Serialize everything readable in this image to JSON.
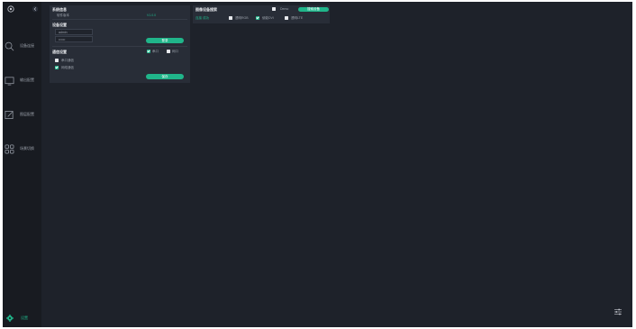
{
  "sidebar": {
    "items": [
      {
        "label": "设备连接"
      },
      {
        "label": "输出配置"
      },
      {
        "label": "图层配置"
      },
      {
        "label": "场景切换"
      }
    ],
    "settings_label": "设置"
  },
  "basic_info": {
    "title": "系统信息",
    "row_label": "软件版本",
    "row_value": "V1.0.0"
  },
  "device_settings": {
    "title": "设备设置",
    "username_value": "admin",
    "password_value": "••••••",
    "login_button": "登录"
  },
  "comm_settings": {
    "title": "通信设置",
    "opt_a": "串口",
    "opt_b": "网口",
    "serial_label": "串口通信",
    "network_label": "网络通信",
    "save_button": "保存"
  },
  "right_panel": {
    "title": "图像设备搜索",
    "demo_label": "Demo",
    "connect_button": "搜索设备",
    "status_text": "连接 成功",
    "option1": "透明RGB",
    "option2": "使能DVI",
    "option3": "透明LTE"
  },
  "colors": {
    "accent": "#20b58a",
    "background": "#1e222a",
    "sidebar": "#181b21",
    "panel": "#282d37"
  }
}
